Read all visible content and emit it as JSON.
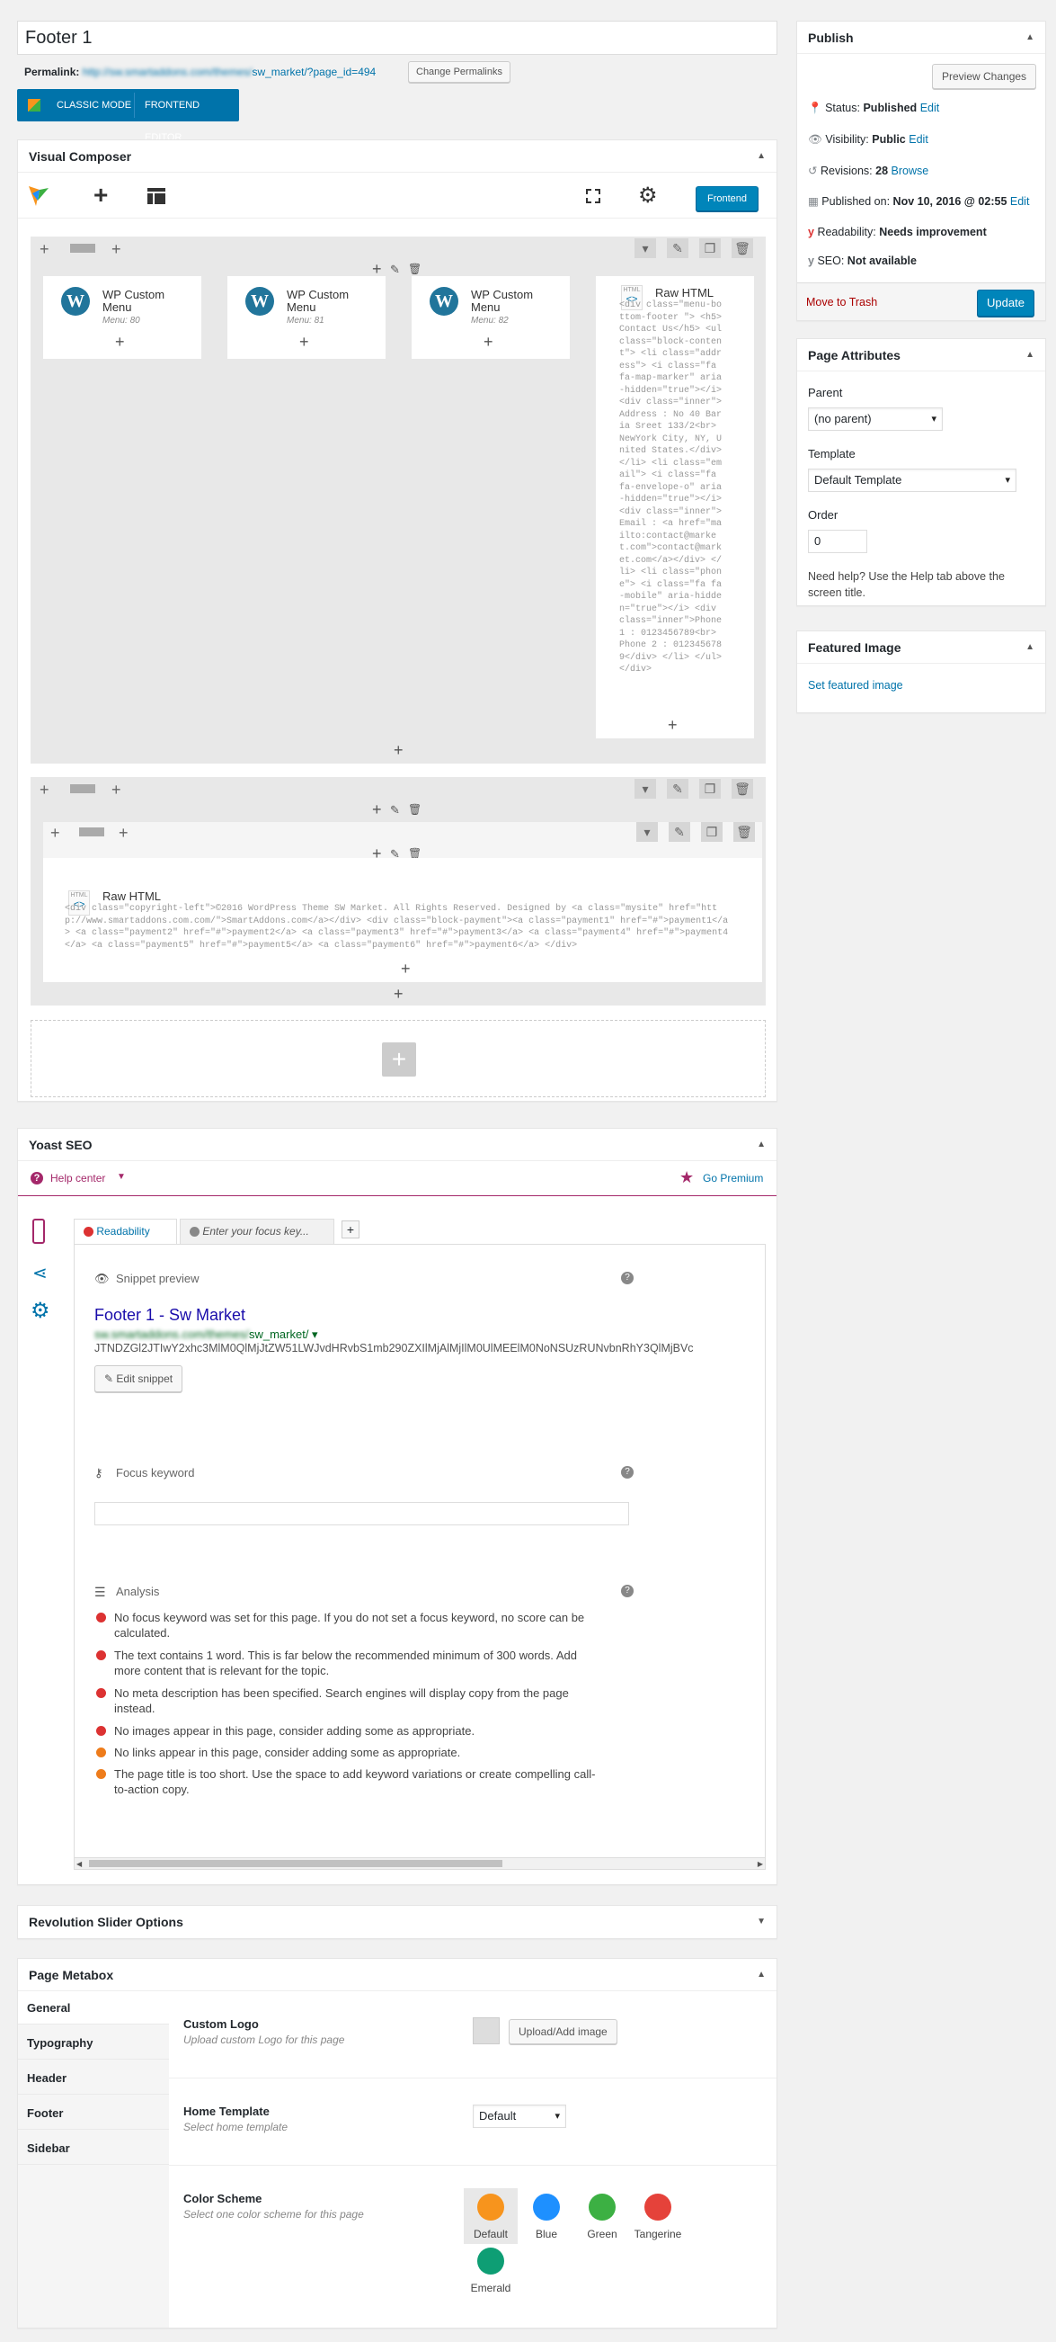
{
  "title_value": "Footer 1",
  "permalink": {
    "label": "Permalink:",
    "url_blur": "http://sw.smartaddons.com/themes/",
    "url": "sw_market/?page_id=494",
    "button": "Change Permalinks"
  },
  "composer_mode": {
    "classic": "CLASSIC MODE",
    "frontend": "FRONTEND EDITOR"
  },
  "vc": {
    "title": "Visual Composer",
    "frontend_btn": "Frontend",
    "elements": [
      {
        "title": "WP Custom Menu",
        "sub": "Menu: 80"
      },
      {
        "title": "WP Custom Menu",
        "sub": "Menu: 81"
      },
      {
        "title": "WP Custom Menu",
        "sub": "Menu: 82"
      }
    ],
    "raw_html_title": "Raw HTML",
    "raw_html_code": "<div class=\"menu-bottom-footer \"> <h5>Contact Us</h5> <ul class=\"block-content\"> <li class=\"address\"> <i class=\"fa fa-map-marker\" aria-hidden=\"true\"></i> <div class=\"inner\">Address : No 40 Baria Sreet 133/2<br> NewYork City, NY, United States.</div> </li> <li class=\"email\"> <i class=\"fa fa-envelope-o\" aria-hidden=\"true\"></i> <div class=\"inner\">Email : <a href=\"mailto:contact@market.com\">contact@market.com</a></div> </li> <li class=\"phone\"> <i class=\"fa fa-mobile\" aria-hidden=\"true\"></i> <div class=\"inner\">Phone 1 : 0123456789<br> Phone 2 : 0123456789</div> </li> </ul> </div>",
    "raw_html2_title": "Raw HTML",
    "raw_html2_code": "<div class=\"copyright-left\">©2016 WordPress Theme SW Market. All Rights Reserved. Designed by <a class=\"mysite\" href=\"http://www.smartaddons.com.com/\">SmartAddons.com</a></div> <div class=\"block-payment\"><a class=\"payment1\" href=\"#\">payment1</a> <a class=\"payment2\" href=\"#\">payment2</a> <a class=\"payment3\" href=\"#\">payment3</a> <a class=\"payment4\" href=\"#\">payment4</a> <a class=\"payment5\" href=\"#\">payment5</a> <a class=\"payment6\" href=\"#\">payment6</a> </div>"
  },
  "yoast": {
    "title": "Yoast SEO",
    "help": "Help center",
    "premium": "Go Premium",
    "tab_readability": "Readability",
    "tab_focus": "Enter your focus key...",
    "snippet_label": "Snippet preview",
    "snippet_title": "Footer 1 - Sw Market",
    "snippet_url_blur": "sw.smartaddons.com/themes/",
    "snippet_url": "sw_market/",
    "snippet_desc": "JTNDZGl2JTIwY2xhc3MlM0QlMjJtZW51LWJvdHRvbS1mb290ZXIlMjAlMjIlM0UlMEElM0NoNSUzRUNvbnRhY3QlMjBVc",
    "edit_snippet": "Edit snippet",
    "focus_label": "Focus keyword",
    "analysis_label": "Analysis",
    "analysis": [
      {
        "color": "#dc3232",
        "text": "No focus keyword was set for this page. If you do not set a focus keyword, no score can be calculated."
      },
      {
        "color": "#dc3232",
        "text": "The text contains 1 word. This is far below the recommended minimum of 300 words. Add more content that is relevant for the topic."
      },
      {
        "color": "#dc3232",
        "text": "No meta description has been specified. Search engines will display copy from the page instead."
      },
      {
        "color": "#dc3232",
        "text": "No images appear in this page, consider adding some as appropriate."
      },
      {
        "color": "#ee7c1b",
        "text": "No links appear in this page, consider adding some as appropriate."
      },
      {
        "color": "#ee7c1b",
        "text": "The page title is too short. Use the space to add keyword variations or create compelling call-to-action copy."
      }
    ]
  },
  "rev_title": "Revolution Slider Options",
  "metabox": {
    "title": "Page Metabox",
    "tabs": [
      "General",
      "Typography",
      "Header",
      "Footer",
      "Sidebar"
    ],
    "logo_label": "Custom Logo",
    "logo_sub": "Upload custom Logo for this page",
    "upload_btn": "Upload/Add image",
    "home_label": "Home Template",
    "home_sub": "Select home template",
    "home_value": "Default",
    "scheme_label": "Color Scheme",
    "scheme_sub": "Select one color scheme for this page",
    "schemes": [
      {
        "name": "Default",
        "color": "#f7941d"
      },
      {
        "name": "Blue",
        "color": "#1e90ff"
      },
      {
        "name": "Green",
        "color": "#3cb043"
      },
      {
        "name": "Tangerine",
        "color": "#e5423a"
      },
      {
        "name": "Emerald",
        "color": "#0e9e74"
      }
    ]
  },
  "publish": {
    "title": "Publish",
    "preview": "Preview Changes",
    "status_label": "Status:",
    "status": "Published",
    "visibility_label": "Visibility:",
    "visibility": "Public",
    "revisions_label": "Revisions:",
    "revisions": "28",
    "browse": "Browse",
    "published_label": "Published on:",
    "published": "Nov 10, 2016 @ 02:55",
    "edit": "Edit",
    "readability_label": "Readability:",
    "readability": "Needs improvement",
    "seo_label": "SEO:",
    "seo": "Not available",
    "trash": "Move to Trash",
    "update": "Update"
  },
  "attributes": {
    "title": "Page Attributes",
    "parent_label": "Parent",
    "parent": "(no parent)",
    "template_label": "Template",
    "template": "Default Template",
    "order_label": "Order",
    "order": "0",
    "help": "Need help? Use the Help tab above the screen title."
  },
  "featured": {
    "title": "Featured Image",
    "link": "Set featured image"
  }
}
